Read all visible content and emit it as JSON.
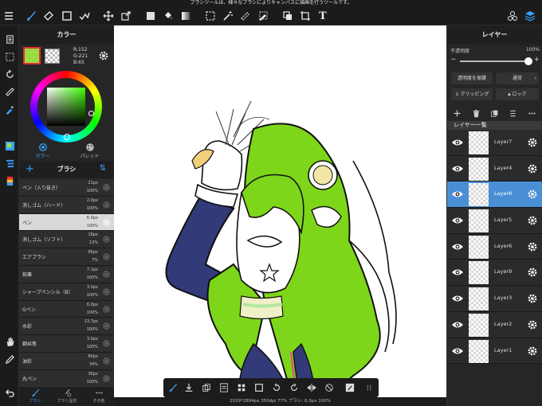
{
  "status_hint": "ブラシツールは、様々なブラシによりキャンバスに描画を行うツールです。",
  "toolbar": {
    "left": [
      "menu-icon",
      "brush-icon",
      "eraser-icon",
      "rect-select-icon",
      "magic-icon"
    ],
    "mid": [
      "move-icon",
      "transform-icon"
    ],
    "right": [
      "fill-color-icon",
      "bucket-icon",
      "gradient-icon",
      "select-rect-icon",
      "wand-icon",
      "lasso-icon",
      "pen-select-icon",
      "copy-icon",
      "crop-icon",
      "text-icon"
    ],
    "far_right": [
      "materials-icon",
      "layers-icon"
    ],
    "text_tool_label": "T"
  },
  "left_strip": {
    "icons": [
      "pages-icon",
      "selection-icon",
      "rotate-icon",
      "ruler-icon",
      "eyedropper-icon",
      "color-panel-icon",
      "layer-panel-icon",
      "brush-panel-icon",
      "hand-icon",
      "pencil-icon",
      "undo-icon"
    ]
  },
  "color_panel": {
    "title": "カラー",
    "main_color": "#98dd41",
    "r": "R:152",
    "g": "G:221",
    "b": "B:65",
    "tabs": [
      {
        "label": "カラー"
      },
      {
        "label": "パレット"
      }
    ]
  },
  "brush_panel": {
    "title": "ブラシ",
    "brushes": [
      {
        "name": "ペン（入り抜き）",
        "size": "21px",
        "opacity": "100%"
      },
      {
        "name": "消しゴム（ハード）",
        "size": "2.0px",
        "opacity": "100%"
      },
      {
        "name": "ペン",
        "size": "6.0px",
        "opacity": "100%"
      },
      {
        "name": "消しゴム（ソフト）",
        "size": "16px",
        "opacity": "13%"
      },
      {
        "name": "エアブラシ",
        "size": "95px",
        "opacity": "7%"
      },
      {
        "name": "鉛筆",
        "size": "7.1px",
        "opacity": "100%"
      },
      {
        "name": "シャープペンシル（B）",
        "size": "3.0px",
        "opacity": "100%"
      },
      {
        "name": "Gペン",
        "size": "6.0px",
        "opacity": "100%"
      },
      {
        "name": "水彩",
        "size": "13.7px",
        "opacity": "100%"
      },
      {
        "name": "鋼丝笔",
        "size": "3.0px",
        "opacity": "100%"
      },
      {
        "name": "油彩",
        "size": "80px",
        "opacity": "34%"
      },
      {
        "name": "丸ペン",
        "size": "35px",
        "opacity": "100%"
      }
    ],
    "selected_index": 2,
    "footer": [
      {
        "label": "ブラシ"
      },
      {
        "label": "ブラシ設定"
      },
      {
        "label": "その他"
      }
    ]
  },
  "canvas_status": "2039*2894px 350dpi 77% ブラシ: 6.0px 100%",
  "layer_panel": {
    "title": "レイヤー",
    "opacity_label": "不透明度",
    "opacity_value": "100%",
    "opacity_fraction": 1.0,
    "protect_label": "透明度を保護",
    "blend_label": "通常",
    "clipping_label": "クリッピング",
    "lock_label": "ロック",
    "list_title": "レイヤー一覧",
    "layers": [
      {
        "name": "Layer7"
      },
      {
        "name": "Layer4"
      },
      {
        "name": "Layer8"
      },
      {
        "name": "Layer5"
      },
      {
        "name": "Layer6"
      },
      {
        "name": "Layer9"
      },
      {
        "name": "Layer3"
      },
      {
        "name": "Layer2"
      },
      {
        "name": "Layer1"
      }
    ],
    "selected_index": 2
  },
  "colors": {
    "accent": "#3aa0ff",
    "hair": "#7ed61a",
    "sleeve": "#323a78"
  }
}
